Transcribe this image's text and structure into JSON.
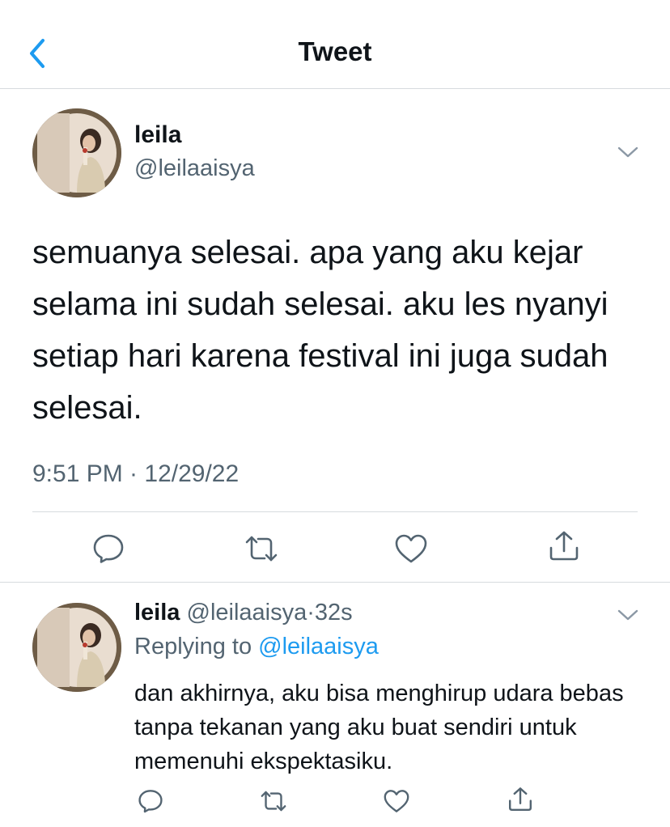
{
  "header": {
    "title": "Tweet",
    "back_icon": "chevron-left-icon"
  },
  "colors": {
    "accent": "#1d9bf0",
    "text": "#0f1419",
    "secondary": "#536471",
    "divider": "#d7dbde"
  },
  "tweet": {
    "display_name": "leila",
    "handle": "@leilaaisya",
    "text": "semuanya selesai. apa yang aku kejar selama ini sudah selesai. aku les nyanyi setiap hari karena festival ini juga sudah selesai.",
    "timestamp": "9:51 PM · 12/29/22",
    "actions": [
      "reply-icon",
      "retweet-icon",
      "like-icon",
      "share-icon"
    ]
  },
  "reply": {
    "display_name": "leila",
    "handle": "@leilaaisya",
    "separator": "·",
    "time_ago": "32s",
    "replying_prefix": "Replying to ",
    "replying_handle": "@leilaaisya",
    "text": "dan akhirnya, aku bisa menghirup udara bebas tanpa tekanan yang aku buat sendiri untuk memenuhi ekspektasiku.",
    "actions": [
      "reply-icon",
      "retweet-icon",
      "like-icon",
      "share-icon"
    ]
  }
}
